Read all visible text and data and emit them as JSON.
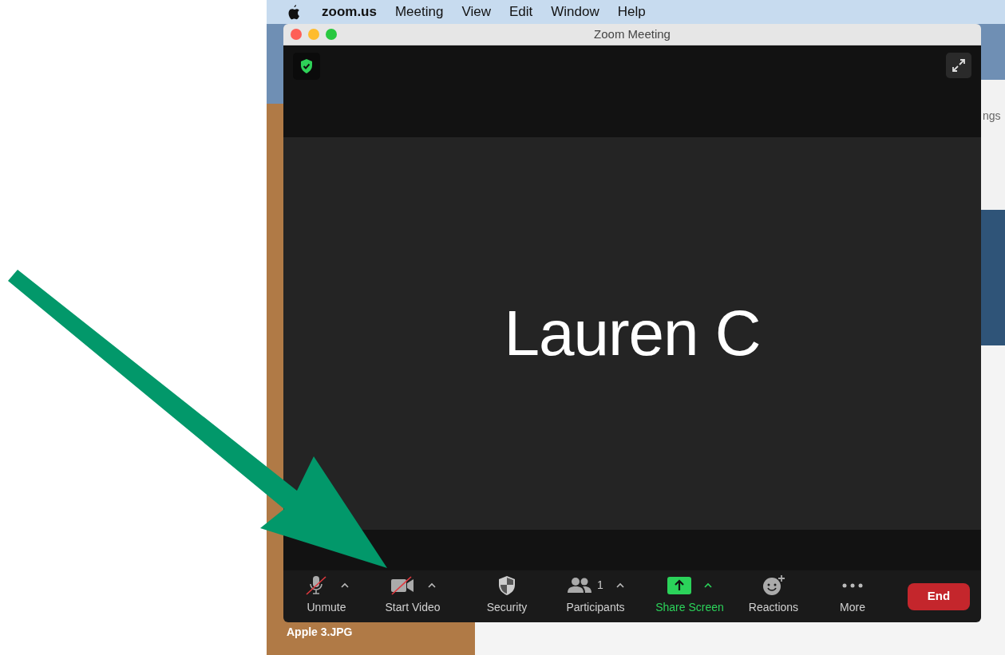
{
  "menu_bar": {
    "app": "zoom.us",
    "items": [
      "Meeting",
      "View",
      "Edit",
      "Window",
      "Help"
    ]
  },
  "desktop": {
    "side_label": "ngs",
    "file_label": "Apple 3.JPG"
  },
  "window": {
    "title": "Zoom Meeting"
  },
  "participant": {
    "name": "Lauren C"
  },
  "toolbar": [
    {
      "kind": "mic",
      "label": "Unmute",
      "off": true,
      "caret": true
    },
    {
      "kind": "video",
      "label": "Start Video",
      "off": true,
      "caret": true
    },
    {
      "kind": "security",
      "label": "Security",
      "caret": false
    },
    {
      "kind": "participants",
      "label": "Participants",
      "count": "1",
      "caret": true
    },
    {
      "kind": "share",
      "label": "Share Screen",
      "caret": true,
      "highlight": true
    },
    {
      "kind": "reactions",
      "label": "Reactions",
      "caret": false
    },
    {
      "kind": "more",
      "label": "More",
      "caret": false
    }
  ],
  "end_button": {
    "label": "End"
  }
}
